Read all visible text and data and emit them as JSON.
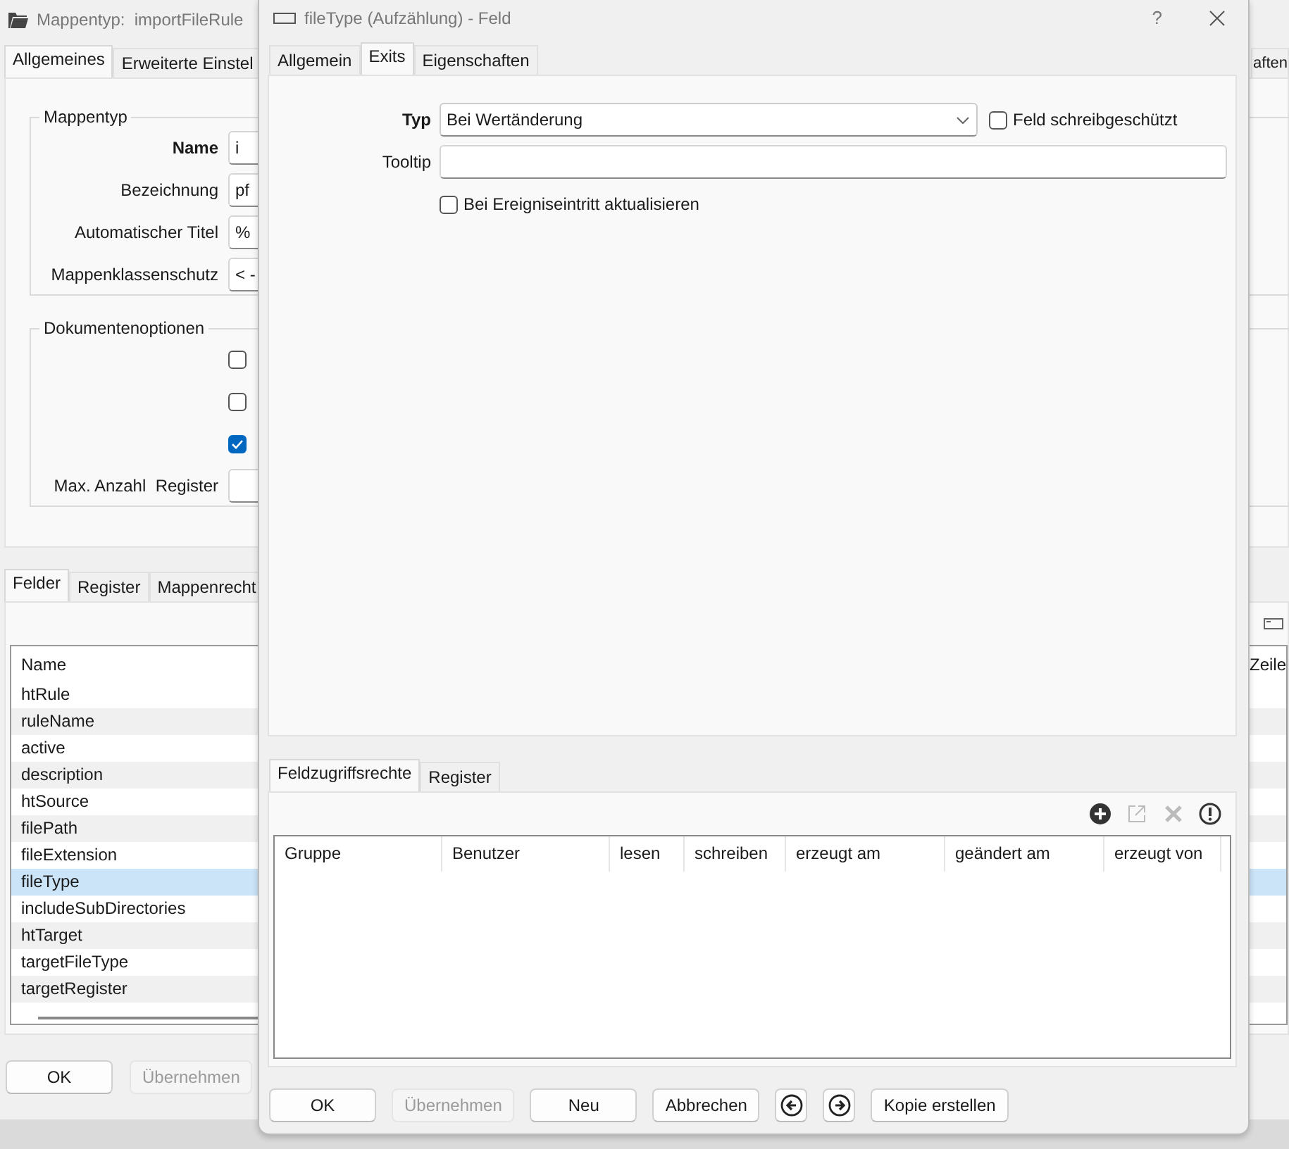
{
  "background_window": {
    "title": "Mappentyp:  importFileRule",
    "tabs": [
      {
        "label": "Allgemeines",
        "selected": true
      },
      {
        "label": "Erweiterte Einstel",
        "selected": false
      }
    ],
    "right_tab": {
      "label": "aften",
      "selected": false
    },
    "mappentyp_group": {
      "title": "Mappentyp",
      "fields": [
        {
          "label": "Name",
          "value": "i",
          "emphasized": true
        },
        {
          "label": "Bezeichnung",
          "value": "pf",
          "emphasized": false
        },
        {
          "label": "Automatischer Titel",
          "value": "%",
          "emphasized": false
        },
        {
          "label": "Mappenklassenschutz",
          "value": "< -",
          "emphasized": false
        }
      ]
    },
    "document_options_group": {
      "title": "Dokumentenoptionen",
      "checkboxes": [
        {
          "checked": false
        },
        {
          "checked": false
        },
        {
          "checked": true
        }
      ],
      "max_registers": {
        "label": "Max. Anzahl  Register"
      }
    },
    "lower_tabs": [
      {
        "label": "Felder",
        "selected": true
      },
      {
        "label": "Register",
        "selected": false
      },
      {
        "label": "Mappenrecht",
        "selected": false
      }
    ],
    "fields_table": {
      "columns": [
        "Name"
      ],
      "right_column": "Zeile",
      "rows": [
        {
          "name": "htRule",
          "selected": false
        },
        {
          "name": "ruleName",
          "selected": false
        },
        {
          "name": "active",
          "selected": false
        },
        {
          "name": "description",
          "selected": false
        },
        {
          "name": "htSource",
          "selected": false
        },
        {
          "name": "filePath",
          "selected": false
        },
        {
          "name": "fileExtension",
          "selected": false
        },
        {
          "name": "fileType",
          "selected": true
        },
        {
          "name": "includeSubDirectories",
          "selected": false
        },
        {
          "name": "htTarget",
          "selected": false
        },
        {
          "name": "targetFileType",
          "selected": false
        },
        {
          "name": "targetRegister",
          "selected": false
        }
      ]
    },
    "buttons": [
      {
        "label": "OK",
        "disabled": false
      },
      {
        "label": "Übernehmen",
        "disabled": true
      }
    ]
  },
  "dialog": {
    "title": "fileType (Aufzählung) - Feld",
    "help": "?",
    "tabs": [
      {
        "label": "Allgemein",
        "selected": false
      },
      {
        "label": "Exits",
        "selected": true
      },
      {
        "label": "Eigenschaften",
        "selected": false
      }
    ],
    "typ": {
      "label": "Typ",
      "value": "Bei Wertänderung",
      "emphasized": true
    },
    "readonly_checkbox": {
      "label": "Feld schreibgeschützt",
      "checked": false
    },
    "tooltip": {
      "label": "Tooltip",
      "emphasized": false
    },
    "update_checkbox": {
      "label": "Bei Ereigniseintritt aktualisieren",
      "checked": false
    },
    "lower_tabs": [
      {
        "label": "Feldzugriffsrechte",
        "selected": true
      },
      {
        "label": "Register",
        "selected": false
      }
    ],
    "toolbar": [
      {
        "kind": "add",
        "disabled": false
      },
      {
        "kind": "open",
        "disabled": true
      },
      {
        "kind": "delete",
        "disabled": true
      },
      {
        "kind": "alert",
        "disabled": false
      }
    ],
    "rights_table": {
      "columns": [
        "Gruppe",
        "Benutzer",
        "lesen",
        "schreiben",
        "erzeugt am",
        "geändert am",
        "erzeugt von"
      ]
    },
    "buttons": [
      {
        "kind": "text",
        "label": "OK",
        "disabled": false
      },
      {
        "kind": "text",
        "label": "Übernehmen",
        "disabled": true
      },
      {
        "kind": "text",
        "label": "Neu",
        "disabled": false
      },
      {
        "kind": "text",
        "label": "Abbrechen",
        "disabled": false
      },
      {
        "kind": "previous",
        "disabled": false
      },
      {
        "kind": "next",
        "disabled": false
      },
      {
        "kind": "text",
        "label": "Kopie erstellen",
        "disabled": false
      }
    ]
  }
}
